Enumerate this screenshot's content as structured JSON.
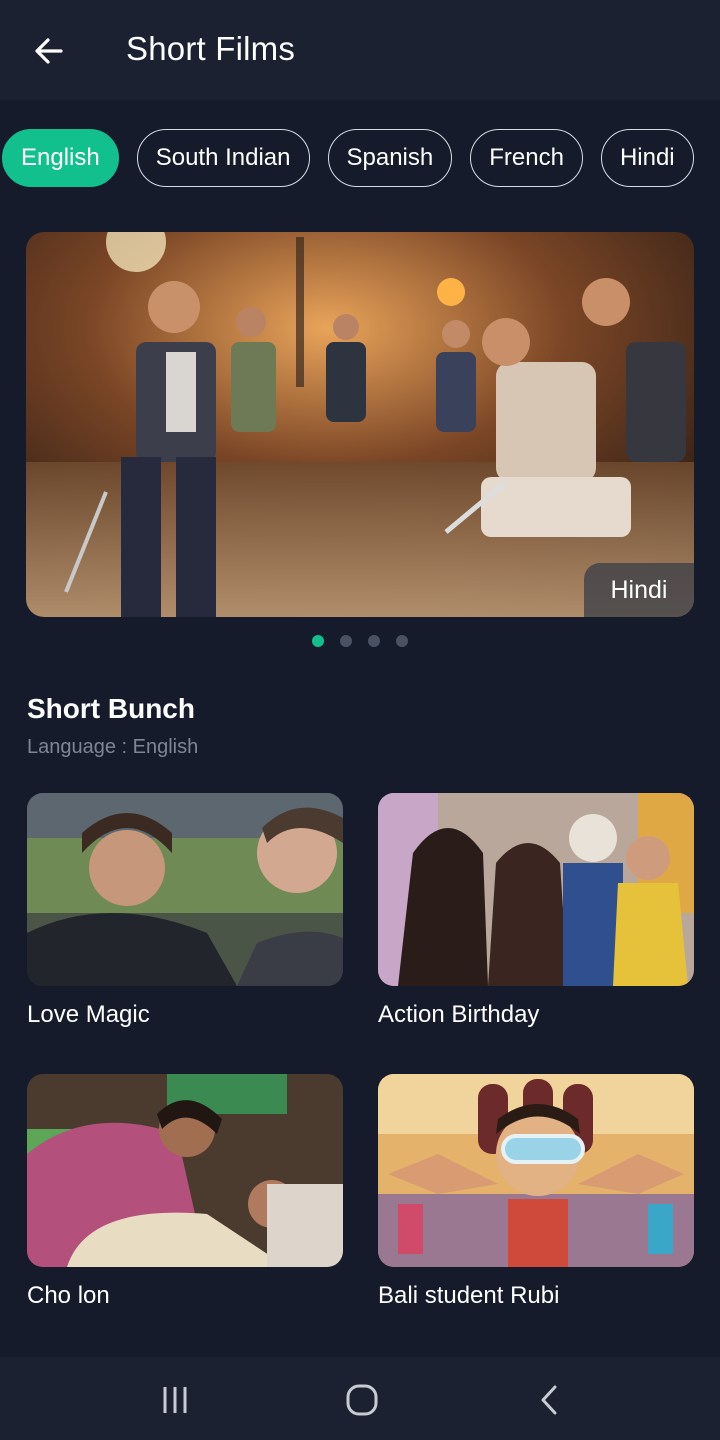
{
  "header": {
    "title": "Short Films",
    "back_icon": "arrow-left-icon"
  },
  "language_chips": [
    {
      "label": "English",
      "active": true
    },
    {
      "label": "South Indian",
      "active": false
    },
    {
      "label": "Spanish",
      "active": false
    },
    {
      "label": "French",
      "active": false
    },
    {
      "label": "Hindi",
      "active": false
    }
  ],
  "banner": {
    "badge": "Hindi",
    "slide_count": 4,
    "active_slide": 1
  },
  "section": {
    "title": "Short Bunch",
    "subtitle": "Language : English"
  },
  "films": [
    {
      "title": "Love Magic"
    },
    {
      "title": "Action Birthday"
    },
    {
      "title": "Cho lon"
    },
    {
      "title": "Bali student Rubi"
    }
  ],
  "navbar": {
    "recent_icon": "recent-apps-icon",
    "home_icon": "home-icon",
    "back_icon": "nav-back-icon"
  },
  "colors": {
    "background": "#161b2b",
    "header": "#1b2130",
    "accent": "#12c08d"
  }
}
